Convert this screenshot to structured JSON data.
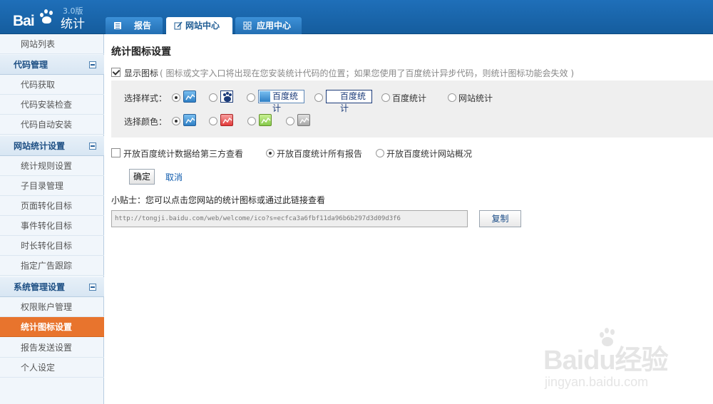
{
  "brand": {
    "logo": "Baidu",
    "product": "统计",
    "version": "3.0版"
  },
  "tabs": [
    {
      "label": "报告",
      "icon": "document-icon",
      "active": false
    },
    {
      "label": "网站中心",
      "icon": "edit-icon",
      "active": true
    },
    {
      "label": "应用中心",
      "icon": "grid-icon",
      "active": false
    }
  ],
  "sidebar": {
    "site_list": "网站列表",
    "groups": [
      {
        "title": "代码管理",
        "items": [
          "代码获取",
          "代码安装检查",
          "代码自动安装"
        ]
      },
      {
        "title": "网站统计设置",
        "items": [
          "统计规则设置",
          "子目录管理",
          "页面转化目标",
          "事件转化目标",
          "时长转化目标",
          "指定广告跟踪"
        ]
      },
      {
        "title": "系统管理设置",
        "items": [
          "权限账户管理",
          "统计图标设置",
          "报告发送设置",
          "个人设定"
        ]
      }
    ],
    "active_item": "统计图标设置"
  },
  "main": {
    "title": "统计图标设置",
    "show_icon": {
      "checked": true,
      "label": "显示图标",
      "note": "( 图标或文字入口将出现在您安装统计代码的位置；如果您使用了百度统计异步代码，则统计图标功能会失效 )"
    },
    "style": {
      "label": "选择样式：",
      "options": [
        {
          "label": "",
          "icon": "chart-icon",
          "checked": true
        },
        {
          "label": "",
          "icon": "paw-icon",
          "checked": false
        },
        {
          "label": "百度统计",
          "icon": "chart-logo-icon",
          "checked": false
        },
        {
          "label": "百度统计",
          "icon": "paw-logo-icon",
          "checked": false
        },
        {
          "label": "百度统计",
          "icon": "",
          "checked": false
        },
        {
          "label": "网站统计",
          "icon": "",
          "checked": false
        }
      ]
    },
    "color": {
      "label": "选择颜色：",
      "options": [
        {
          "name": "blue",
          "color": "#2f7fc5",
          "checked": true
        },
        {
          "name": "red",
          "color": "#e23b3b",
          "checked": false
        },
        {
          "name": "green",
          "color": "#85c94b",
          "checked": false
        },
        {
          "name": "gray",
          "color": "#a7a7a7",
          "checked": false
        }
      ]
    },
    "share": {
      "third_party": {
        "label": "开放百度统计数据给第三方查看",
        "checked": false
      },
      "options": [
        {
          "label": "开放百度统计所有报告",
          "checked": true
        },
        {
          "label": "开放百度统计网站概况",
          "checked": false
        }
      ]
    },
    "buttons": {
      "confirm": "确定",
      "cancel": "取消",
      "copy": "复制"
    },
    "tip": "小贴士：您可以点击您网站的统计图标或通过此链接查看",
    "url": "http://tongji.baidu.com/web/welcome/ico?s=ecfca3a6fbf11da96b6b297d3d09d3f6"
  },
  "watermark": {
    "big_text": "Baidu经验",
    "small_text": "jingyan.baidu.com"
  }
}
